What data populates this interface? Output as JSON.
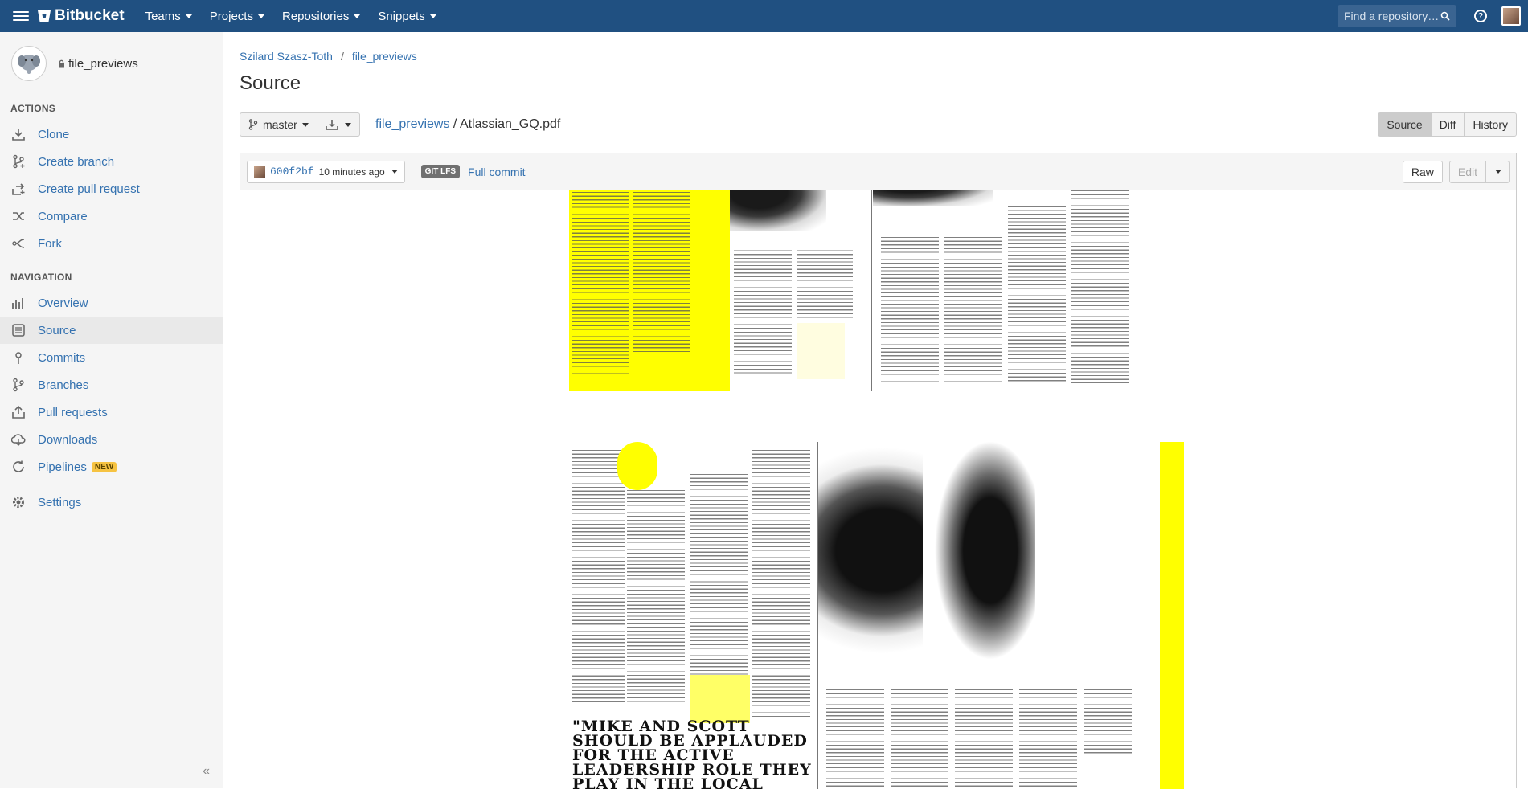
{
  "topnav": {
    "brand": "Bitbucket",
    "menu": [
      "Teams",
      "Projects",
      "Repositories",
      "Snippets"
    ],
    "search_placeholder": "Find a repository…",
    "help_label": "?"
  },
  "sidebar": {
    "repo_name": "file_previews",
    "actions_title": "ACTIONS",
    "actions": [
      {
        "label": "Clone",
        "icon": "clone-icon"
      },
      {
        "label": "Create branch",
        "icon": "branch-icon"
      },
      {
        "label": "Create pull request",
        "icon": "pull-request-icon"
      },
      {
        "label": "Compare",
        "icon": "compare-icon"
      },
      {
        "label": "Fork",
        "icon": "fork-icon"
      }
    ],
    "navigation_title": "NAVIGATION",
    "navigation": [
      {
        "label": "Overview",
        "icon": "overview-icon"
      },
      {
        "label": "Source",
        "icon": "source-icon",
        "active": true
      },
      {
        "label": "Commits",
        "icon": "commits-icon"
      },
      {
        "label": "Branches",
        "icon": "branches-icon"
      },
      {
        "label": "Pull requests",
        "icon": "pull-requests-icon"
      },
      {
        "label": "Downloads",
        "icon": "downloads-icon"
      },
      {
        "label": "Pipelines",
        "icon": "pipelines-icon",
        "badge": "NEW"
      },
      {
        "label": "Settings",
        "icon": "settings-icon"
      }
    ],
    "collapse_label": "«"
  },
  "breadcrumb": {
    "owner": "Szilard Szasz-Toth",
    "separator": "/",
    "repo": "file_previews"
  },
  "page_title": "Source",
  "branch": {
    "name": "master"
  },
  "file_path": {
    "dir": "file_previews",
    "separator": " / ",
    "file": "Atlassian_GQ.pdf"
  },
  "view_tabs": [
    "Source",
    "Diff",
    "History"
  ],
  "file_header": {
    "commit_hash": "600f2bf",
    "commit_time": "10 minutes ago",
    "lfs_badge": "GIT LFS",
    "full_commit": "Full commit",
    "raw": "Raw",
    "edit": "Edit"
  },
  "document": {
    "headline": "\"MIKE AND SCOTT SHOULD BE APPLAUDED FOR THE ACTIVE LEADERSHIP ROLE THEY PLAY IN THE LOCAL TECH"
  },
  "colors": {
    "nav_bg": "#205081",
    "link": "#3572b0",
    "highlight": "#ffff00"
  }
}
